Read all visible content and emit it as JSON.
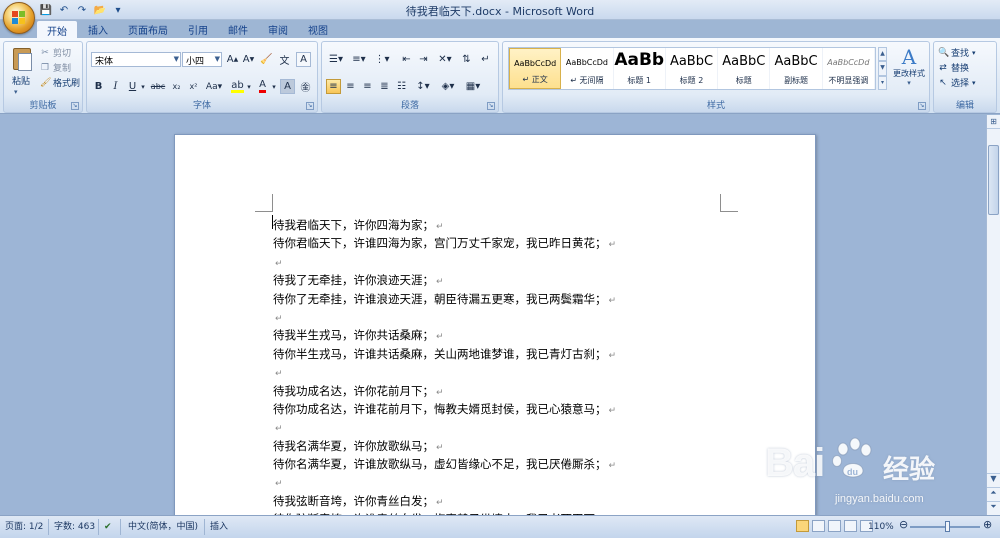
{
  "window": {
    "title": "待我君临天下.docx - Microsoft Word"
  },
  "tabs": [
    {
      "label": "开始",
      "active": true
    },
    {
      "label": "插入"
    },
    {
      "label": "页面布局"
    },
    {
      "label": "引用"
    },
    {
      "label": "邮件"
    },
    {
      "label": "审阅"
    },
    {
      "label": "视图"
    }
  ],
  "clipboard": {
    "paste_label": "粘贴",
    "cut_label": "剪切",
    "copy_label": "复制",
    "format_painter_label": "格式刷",
    "group_label": "剪贴板"
  },
  "font": {
    "font_name": "宋体",
    "font_size": "小四",
    "group_label": "字体"
  },
  "paragraph": {
    "group_label": "段落"
  },
  "styles": {
    "items": [
      {
        "preview": "AaBbCcDd",
        "name": "↵ 正文",
        "selected": true
      },
      {
        "preview": "AaBbCcDd",
        "name": "↵ 无间隔"
      },
      {
        "preview": "AaBb",
        "name": "标题 1"
      },
      {
        "preview": "AaBbC",
        "name": "标题 2"
      },
      {
        "preview": "AaBbC",
        "name": "标题"
      },
      {
        "preview": "AaBbC",
        "name": "副标题"
      },
      {
        "preview": "AaBbCcDd",
        "name": "不明显强调"
      }
    ],
    "change_styles_label": "更改样式",
    "group_label": "样式"
  },
  "editing": {
    "find_label": "查找",
    "replace_label": "替换",
    "select_label": "选择",
    "group_label": "编辑"
  },
  "document": {
    "lines": [
      "待我君临天下，许你四海为家；",
      "待你君临天下，许谁四海为家，宫门万丈千家宠，我已昨日黄花；",
      "",
      "待我了无牵挂，许你浪迹天涯；",
      "待你了无牵挂，许谁浪迹天涯，朝臣待漏五更寒，我已两鬓霜华；",
      "",
      "待我半生戎马，许你共话桑麻；",
      "待你半生戎马，许谁共话桑麻，关山两地谁梦谁，我已青灯古刹；",
      "",
      "待我功成名达，许你花前月下；",
      "待你功成名达，许谁花前月下，悔教夫婿觅封侯，我已心猿意马；",
      "",
      "待我名满华夏，许你放歌纵马；",
      "待你名满华夏，许谁放歌纵马，虚幻皆缘心不足，我已厌倦厮杀；",
      "",
      "待我弦断音垮，许你青丝白发；",
      "待你弦断音垮，许谁青丝白发，梅妻鹤子纵情去，我已老死田下；"
    ],
    "paragraph_mark": "↵"
  },
  "watermark": {
    "brand_left": "Bai",
    "brand_right": "经验",
    "url": "jingyan.baidu.com"
  },
  "statusbar": {
    "page": "页面: 1/2",
    "word_count": "字数: 463",
    "language": "中文(简体，中国)",
    "mode": "插入",
    "zoom": "110%"
  },
  "colors": {
    "accent": "#15428b",
    "ribbon_bg": "#dfe9f5",
    "doc_bg": "#9db5d6"
  }
}
